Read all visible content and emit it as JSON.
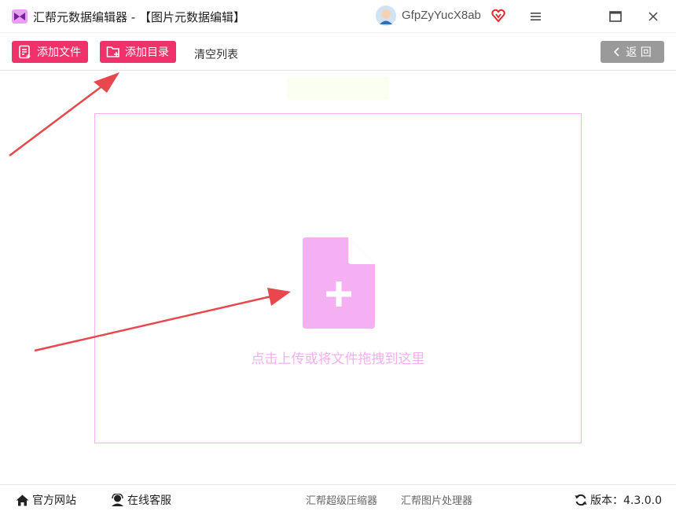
{
  "window": {
    "title": "汇帮元数据编辑器 - 【图片元数据编辑】",
    "user_name": "GfpZyYucX8ab",
    "icons": [
      "app-logo-icon",
      "avatar-icon",
      "vip-heart-icon",
      "menu-icon",
      "maximize-icon",
      "close-icon"
    ]
  },
  "toolbar": {
    "add_file_label": "添加文件",
    "add_dir_label": "添加目录",
    "clear_label": "清空列表",
    "back_label": "返 回"
  },
  "dropzone": {
    "hint": "点击上传或将文件拖拽到这里"
  },
  "footer": {
    "site_label": "官方网站",
    "service_label": "在线客服",
    "compress_label": "汇帮超级压缩器",
    "image_tool_label": "汇帮图片处理器",
    "version_label": "版本：4.3.0.0"
  },
  "colors": {
    "accent": "#f0326a",
    "dropzone_border": "#f2b3f0",
    "upload_icon": "#f5b0f4",
    "annotation_arrow": "#e8474d",
    "back_button": "#9a9a9a"
  }
}
